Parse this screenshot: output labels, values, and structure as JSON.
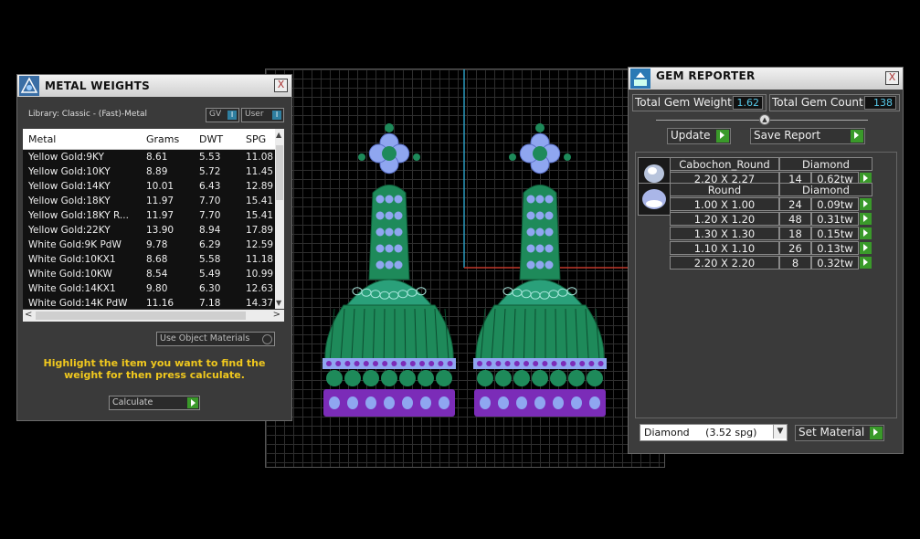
{
  "metal_weights": {
    "title": "METAL WEIGHTS",
    "close_label": "X",
    "library": "Library: Classic - (Fast)-Metal",
    "toggle_gv": "GV",
    "toggle_user": "User",
    "toggle_mark": "I",
    "columns": [
      "Metal",
      "Grams",
      "DWT",
      "SPG"
    ],
    "rows": [
      [
        "Yellow Gold:9KY",
        "8.61",
        "5.53",
        "11.08"
      ],
      [
        "Yellow Gold:10KY",
        "8.89",
        "5.72",
        "11.45"
      ],
      [
        "Yellow Gold:14KY",
        "10.01",
        "6.43",
        "12.89"
      ],
      [
        "Yellow Gold:18KY",
        "11.97",
        "7.70",
        "15.41"
      ],
      [
        "Yellow Gold:18KY R...",
        "11.97",
        "7.70",
        "15.41"
      ],
      [
        "Yellow Gold:22KY",
        "13.90",
        "8.94",
        "17.89"
      ],
      [
        "White Gold:9K PdW",
        "9.78",
        "6.29",
        "12.59"
      ],
      [
        "White Gold:10KX1",
        "8.68",
        "5.58",
        "11.18"
      ],
      [
        "White Gold:10KW",
        "8.54",
        "5.49",
        "10.99"
      ],
      [
        "White Gold:14KX1",
        "9.80",
        "6.30",
        "12.63"
      ],
      [
        "White Gold:14K PdW",
        "11.16",
        "7.18",
        "14.37"
      ]
    ],
    "use_object_materials": "Use Object Materials",
    "hint": "Highlight the item you want to find the weight for then press calculate.",
    "calculate": "Calculate"
  },
  "gem_reporter": {
    "title": "GEM REPORTER",
    "close_label": "X",
    "total_weight_label": "Total Gem Weight",
    "total_weight": "1.62",
    "total_count_label": "Total Gem Count",
    "total_count": "138",
    "update": "Update",
    "save_report": "Save Report",
    "groups": [
      {
        "shape": "Cabochon_Round",
        "material": "Diamond",
        "icon": "cabochon-gem-icon",
        "rows": [
          [
            "2.20 X 2.27",
            "14",
            "0.62tw"
          ]
        ]
      },
      {
        "shape": "Round",
        "material": "Diamond",
        "icon": "round-gem-icon",
        "rows": [
          [
            "1.00 X 1.00",
            "24",
            "0.09tw"
          ],
          [
            "1.20 X 1.20",
            "48",
            "0.31tw"
          ],
          [
            "1.30 X 1.30",
            "18",
            "0.15tw"
          ],
          [
            "1.10 X 1.10",
            "26",
            "0.13tw"
          ],
          [
            "2.20 X 2.20",
            "8",
            "0.32tw"
          ]
        ]
      }
    ],
    "material_select": "Diamond     (3.52 spg)",
    "set_material": "Set Material"
  },
  "colors": {
    "metal_green": "#1e8a5a",
    "gem_blue": "#8fa6f0",
    "purple": "#7b2cb8",
    "accent_blue_text": "#57c8e8",
    "hint_yellow": "#f0c81e"
  }
}
